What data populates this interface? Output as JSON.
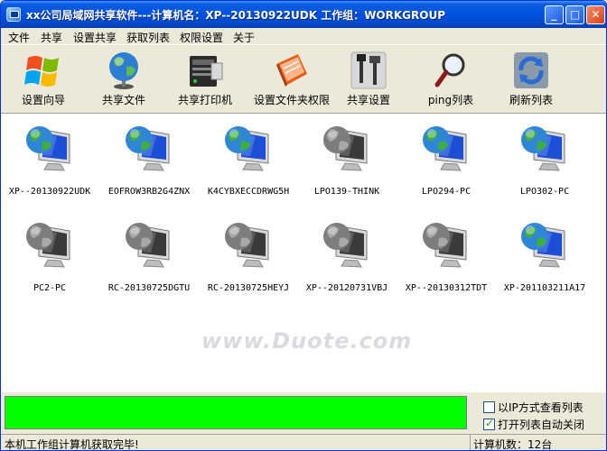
{
  "window": {
    "title": "xx公司局域网共享软件---计算机名：XP--20130922UDK  工作组：WORKGROUP",
    "controls": [
      "_",
      "□",
      "✕"
    ]
  },
  "menu": [
    "文件",
    "共享",
    "设置共享",
    "获取列表",
    "权限设置",
    "关于"
  ],
  "toolbar": [
    {
      "label": "设置向导",
      "icon": "windows-flag-icon"
    },
    {
      "label": "共享文件",
      "icon": "globe-icon"
    },
    {
      "label": "共享打印机",
      "icon": "printer-server-icon"
    },
    {
      "label": "设置文件夹权限",
      "icon": "notebook-icon"
    },
    {
      "label": "共享设置",
      "icon": "tools-icon"
    },
    {
      "label": "ping列表",
      "icon": "magnifier-icon"
    },
    {
      "label": "刷新列表",
      "icon": "refresh-icon"
    }
  ],
  "computers": [
    {
      "name": "XP--20130922UDK",
      "online": true
    },
    {
      "name": "EOFROW3RB2G4ZNX",
      "online": true
    },
    {
      "name": "K4CYBXECCDRWG5H",
      "online": true
    },
    {
      "name": "LPO139-THINK",
      "online": false
    },
    {
      "name": "LPO294-PC",
      "online": true
    },
    {
      "name": "LPO302-PC",
      "online": true
    },
    {
      "name": "PC2-PC",
      "online": false
    },
    {
      "name": "RC-20130725DGTU",
      "online": false
    },
    {
      "name": "RC-20130725HEYJ",
      "online": false
    },
    {
      "name": "XP--20120731VBJ",
      "online": false
    },
    {
      "name": "XP--20130312TDT",
      "online": false
    },
    {
      "name": "XP-201103211A17",
      "online": true
    }
  ],
  "watermark": "www.Duote.com",
  "options": {
    "view_by_ip": "以IP方式查看列表",
    "view_by_ip_checked": false,
    "auto_close": "打开列表自动关闭",
    "auto_close_checked": true
  },
  "status": {
    "message": "本机工作组计算机获取完毕!",
    "count": "计算机数：12台"
  },
  "colors": {
    "progress": "#00ff00",
    "titlebar": "#0053e1"
  }
}
